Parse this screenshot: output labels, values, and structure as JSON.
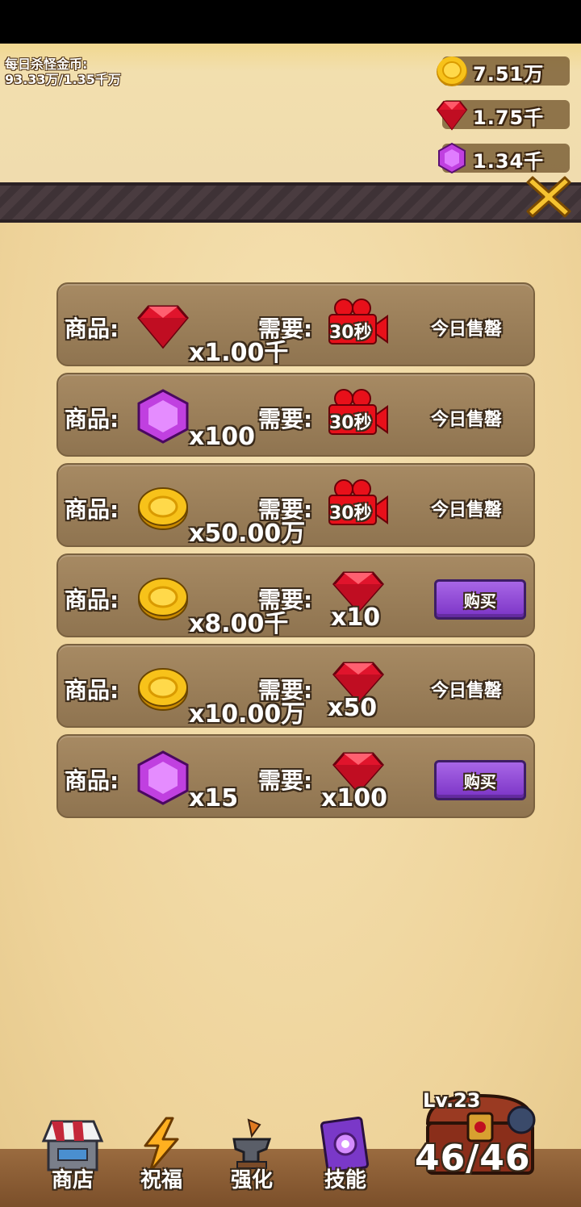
{
  "header": {
    "daily_label": "每日杀怪金币:",
    "daily_value": "93.33万/1.35千万",
    "resources": [
      {
        "icon": "gold-coin-icon",
        "value": "7.51万"
      },
      {
        "icon": "ruby-gem-icon",
        "value": "1.75千"
      },
      {
        "icon": "purple-gem-icon",
        "value": "1.34千"
      }
    ]
  },
  "shop": {
    "item_label": "商品:",
    "need_label": "需要:",
    "rows": [
      {
        "item_icon": "ruby-gem-icon",
        "item_qty": "x1.00千",
        "cost_type": "video-ad-icon",
        "cost_text": "30秒",
        "cost_qty": "",
        "action": "今日售罄",
        "action_type": "soldout"
      },
      {
        "item_icon": "purple-gem-icon",
        "item_qty": "x100",
        "cost_type": "video-ad-icon",
        "cost_text": "30秒",
        "cost_qty": "",
        "action": "今日售罄",
        "action_type": "soldout"
      },
      {
        "item_icon": "gold-coin-icon",
        "item_qty": "x50.00万",
        "cost_type": "video-ad-icon",
        "cost_text": "30秒",
        "cost_qty": "",
        "action": "今日售罄",
        "action_type": "soldout"
      },
      {
        "item_icon": "gold-coin-icon",
        "item_qty": "x8.00千",
        "cost_type": "ruby-gem-icon",
        "cost_text": "",
        "cost_qty": "x10",
        "action": "购买",
        "action_type": "buy"
      },
      {
        "item_icon": "gold-coin-icon",
        "item_qty": "x10.00万",
        "cost_type": "ruby-gem-icon",
        "cost_text": "",
        "cost_qty": "x50",
        "action": "今日售罄",
        "action_type": "soldout"
      },
      {
        "item_icon": "purple-gem-icon",
        "item_qty": "x15",
        "cost_type": "ruby-gem-icon",
        "cost_text": "",
        "cost_qty": "x100",
        "action": "购买",
        "action_type": "buy"
      }
    ]
  },
  "nav": {
    "items": [
      {
        "label": "商店",
        "icon": "shop-stall-icon"
      },
      {
        "label": "祝福",
        "icon": "lightning-icon"
      },
      {
        "label": "强化",
        "icon": "anvil-hammer-icon"
      },
      {
        "label": "技能",
        "icon": "spellbook-icon"
      }
    ]
  },
  "chest": {
    "level": "Lv.23",
    "count": "46/46"
  },
  "colors": {
    "background": "#f0d9a4",
    "row": "#9a7d58",
    "buy_button": "#8a45d6",
    "ruby": "#e0142c",
    "purple_gem": "#c040e0",
    "gold": "#f2b400"
  }
}
